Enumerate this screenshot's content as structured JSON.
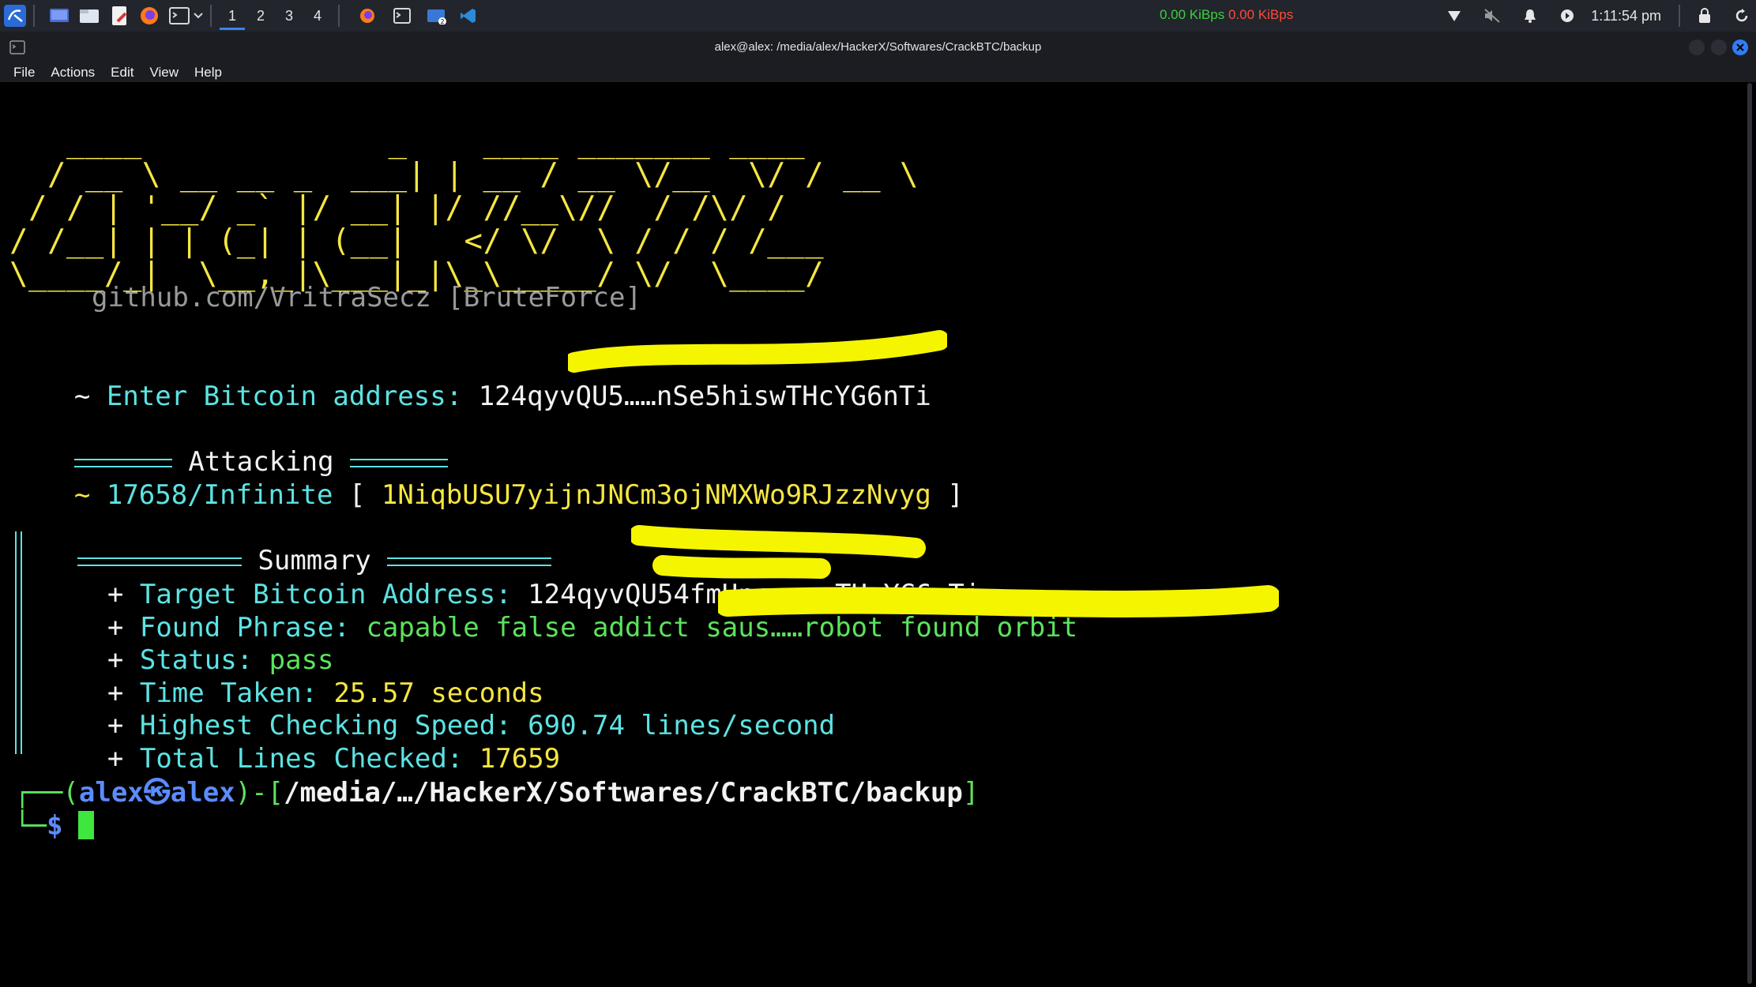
{
  "topbar": {
    "workspaces": [
      "1",
      "2",
      "3",
      "4"
    ],
    "active_workspace": "1",
    "net_down": "0.00 KiBps",
    "net_up": "0.00 KiBps",
    "clock": "1:11:54 pm",
    "icons": [
      "kali-menu-icon",
      "desktop-icon",
      "file-manager-icon",
      "text-editor-icon",
      "firefox-icon",
      "terminal-icon",
      "network-icon",
      "mute-icon",
      "bell-icon",
      "power-icon",
      "lock-icon",
      "refresh-icon"
    ],
    "colors": {
      "down": "#3ad13a",
      "up": "#ff4a3a",
      "accent": "#3b82f6"
    }
  },
  "window": {
    "title": "alex@alex: /media/alex/HackerX/Softwares/CrackBTC/backup"
  },
  "menu": [
    "File",
    "Actions",
    "Edit",
    "View",
    "Help"
  ],
  "terminal": {
    "banner_ascii": "   ____             _    ____ _______ ____\n  / __ \\ __ __ _  ___| | __ / __ \\/__  \\/ / __ \\\n / / | '__/ _` |/ __| |/ //__\\//  / /\\/ /\n/ /__| | | (_| | (__|   </ \\/  \\ / / / /___\n\\____/_|  \\__,_|\\___|_|\\_\\_____/ \\/  \\____/",
    "banner_credit": "github.com/VritraSecz [BruteForce]",
    "prompt_tilde": "~",
    "enter_label": "Enter Bitcoin address:",
    "entered_address": "124qyvQU5……nSe5hiswTHcYG6nTi",
    "attacking_label": "Attacking",
    "attempt_counter": "17658/Infinite",
    "current_candidate": "1NiqbUSU7yijnJNCm3ojNMXWo9RJzzNvyg",
    "summary_label": "Summary",
    "summary": [
      {
        "key": "Target Bitcoin Address:",
        "value": "124qyvQU54fmHnnx……wTHcYG6nTi"
      },
      {
        "key": "Found Phrase:",
        "value": "capable false addict saus……robot found orbit"
      },
      {
        "key": "Status:",
        "value": "pass"
      },
      {
        "key": "Time Taken:",
        "value": "25.57 seconds"
      },
      {
        "key": "Highest Checking Speed:",
        "value": "690.74 lines/second"
      },
      {
        "key": "Total Lines Checked:",
        "value": "17659"
      }
    ],
    "prompt_user": "alex",
    "prompt_host": "alex",
    "prompt_path": "/media/…/HackerX/Softwares/CrackBTC/backup",
    "prompt_symbol": "$"
  }
}
